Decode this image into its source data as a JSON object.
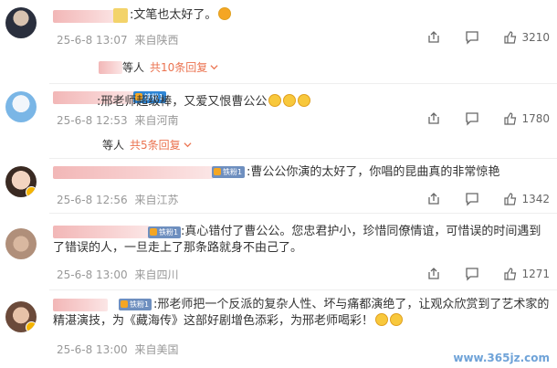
{
  "comments": [
    {
      "text": ":文笔也太好了。",
      "time": "25-6-8 13:07",
      "location": "来自陕西",
      "likes": "3210",
      "replies_names": "等人",
      "replies_more": "共10条回复",
      "fan_badge": ""
    },
    {
      "text": ":邢老师超级棒，又爱又恨曹公公",
      "time": "25-6-8 12:53",
      "location": "来自河南",
      "likes": "1780",
      "replies_names": "等人",
      "replies_more": "共5条回复",
      "fan_badge": "铁粉1"
    },
    {
      "text": ":曹公公你演的太好了，你唱的昆曲真的非常惊艳",
      "time": "25-6-8 12:56",
      "location": "来自江苏",
      "likes": "1342",
      "fan_badge": "铁粉1"
    },
    {
      "text": ":真心错付了曹公公。您忠君护小，珍惜同僚情谊，可惜误的时间遇到了错误的人，一旦走上了那条路就身不由己了。",
      "time": "25-6-8 13:00",
      "location": "来自四川",
      "likes": "1271",
      "fan_badge": "铁粉1"
    },
    {
      "text": ":邢老师把一个反派的复杂人性、坏与痛都演绝了，让观众欣赏到了艺术家的精湛演技，为《藏海传》这部好剧增色添彩，为邢老师喝彩！",
      "time": "25-6-8 13:00",
      "location": "来自美国",
      "fan_badge": "铁粉1"
    }
  ],
  "watermark": "www.365jz.com",
  "icons": {
    "share": "share-icon",
    "comment": "comment-icon",
    "like": "thumb-up-icon"
  },
  "colors": {
    "accent": "#eb7350",
    "meta": "#999999",
    "fan_badge": "#2e86d6"
  }
}
